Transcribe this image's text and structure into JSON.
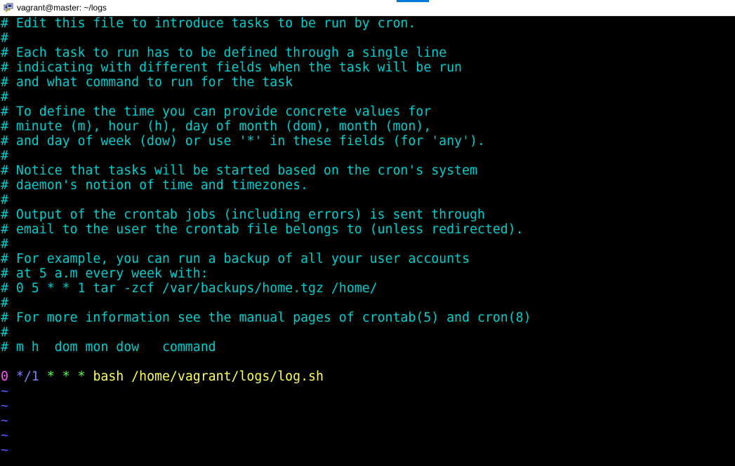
{
  "window": {
    "title": "vagrant@master: ~/logs",
    "icon": "putty-icon"
  },
  "colors": {
    "comment": "#00cdcd",
    "minute": "#ff55ff",
    "hour": "#7f7fff",
    "star": "#55ff55",
    "command": "#ffff55",
    "tilde": "#5c5cff"
  },
  "comments": [
    "# Edit this file to introduce tasks to be run by cron.",
    "#",
    "# Each task to run has to be defined through a single line",
    "# indicating with different fields when the task will be run",
    "# and what command to run for the task",
    "#",
    "# To define the time you can provide concrete values for",
    "# minute (m), hour (h), day of month (dom), month (mon),",
    "# and day of week (dow) or use '*' in these fields (for 'any').",
    "#",
    "# Notice that tasks will be started based on the cron's system",
    "# daemon's notion of time and timezones.",
    "#",
    "# Output of the crontab jobs (including errors) is sent through",
    "# email to the user the crontab file belongs to (unless redirected).",
    "#",
    "# For example, you can run a backup of all your user accounts",
    "# at 5 a.m every week with:",
    "# 0 5 * * 1 tar -zcf /var/backups/home.tgz /home/",
    "#",
    "# For more information see the manual pages of crontab(5) and cron(8)",
    "#",
    "# m h  dom mon dow   command"
  ],
  "cron_entry": {
    "minute": "0",
    "hour": "*/1",
    "dom": "*",
    "mon": "*",
    "dow": "*",
    "command": "bash /home/vagrant/logs/log.sh"
  },
  "tildes": [
    "~",
    "~",
    "~",
    "~",
    "~"
  ]
}
